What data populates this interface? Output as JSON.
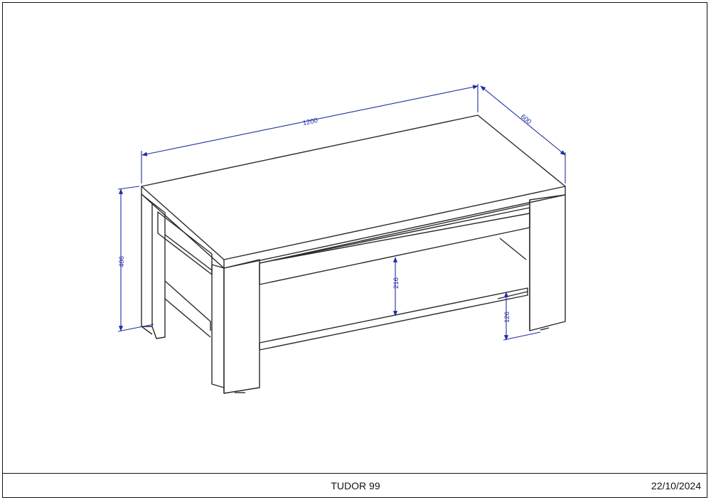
{
  "drawing": {
    "product_name": "TUDOR 99",
    "date": "22/10/2024",
    "dimensions": {
      "width": "1200",
      "depth": "600",
      "height": "486",
      "shelf_gap": "216",
      "shelf_height": "126"
    },
    "colors": {
      "outline": "#2a2a2a",
      "dimension": "#1f2fa3",
      "frame": "#111111"
    }
  }
}
